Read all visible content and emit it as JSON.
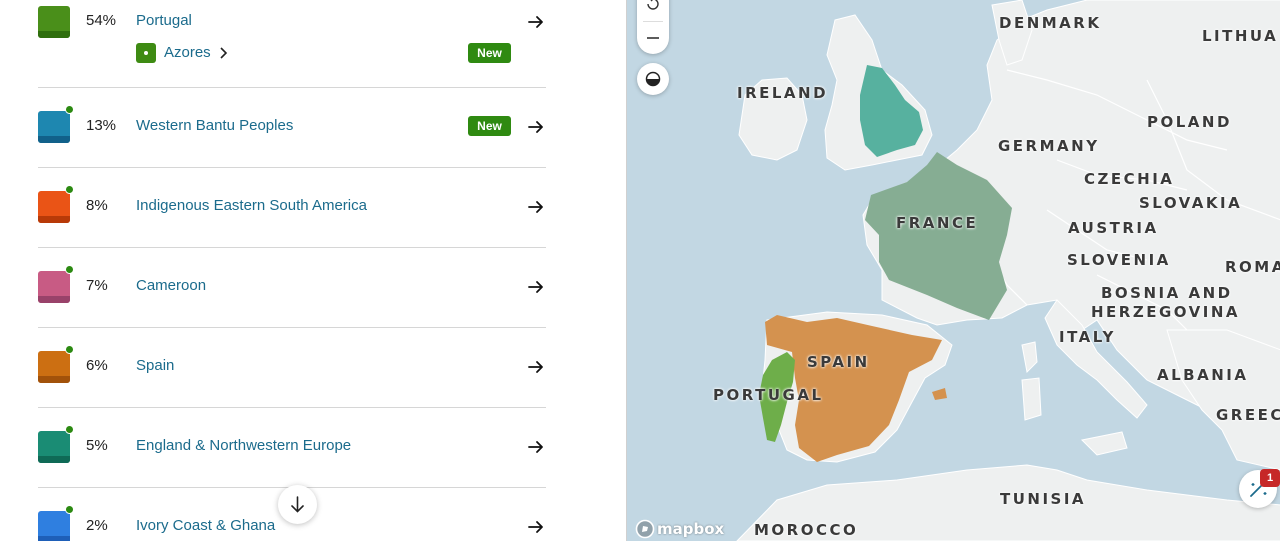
{
  "ethnicities": [
    {
      "pct": "54%",
      "name": "Portugal",
      "color": "#4a8f1a",
      "dark": "#2f6e0e",
      "dot": false,
      "badge": "",
      "sub": {
        "label": "Azores",
        "badge": "New"
      }
    },
    {
      "pct": "13%",
      "name": "Western Bantu Peoples",
      "color": "#1e87b0",
      "dark": "#11618a",
      "dot": true,
      "badge": "New"
    },
    {
      "pct": "8%",
      "name": "Indigenous Eastern South America",
      "color": "#ea5416",
      "dark": "#b83a08",
      "dot": true,
      "badge": ""
    },
    {
      "pct": "7%",
      "name": "Cameroon",
      "color": "#c85b84",
      "dark": "#99426a",
      "dot": true,
      "badge": ""
    },
    {
      "pct": "6%",
      "name": "Spain",
      "color": "#cc6f12",
      "dark": "#a2520a",
      "dot": true,
      "badge": ""
    },
    {
      "pct": "5%",
      "name": "England & Northwestern Europe",
      "color": "#1a8c74",
      "dark": "#0f6a56",
      "dot": true,
      "badge": ""
    },
    {
      "pct": "2%",
      "name": "Ivory Coast & Ghana",
      "color": "#2f7fe0",
      "dark": "#1e5fb8",
      "dot": true,
      "badge": ""
    }
  ],
  "map": {
    "labels": {
      "denmark": "DENMARK",
      "lithuania": "LITHUA",
      "ireland": "IRELAND",
      "poland": "POLAND",
      "germany": "GERMANY",
      "czechia": "CZECHIA",
      "slovakia": "SLOVAKIA",
      "france": "FRANCE",
      "austria": "AUSTRIA",
      "slovenia": "SLOVENIA",
      "romania": "ROMA",
      "bosnia": "BOSNIA AND",
      "herzegovina": "HERZEGOVINA",
      "italy": "ITALY",
      "spain": "SPAIN",
      "portugal": "PORTUGAL",
      "albania": "ALBANIA",
      "greece": "GREEC",
      "tunisia": "TUNISIA",
      "morocco": "MOROCCO"
    },
    "attribution": "mapbox",
    "notification_count": "1",
    "region_colors": {
      "england": "#57b19f",
      "france": "#86ad93",
      "spain": "#d4924f",
      "portugal": "#6eae4a",
      "land": "#eef0f0",
      "water": "#c2d7e3"
    }
  }
}
